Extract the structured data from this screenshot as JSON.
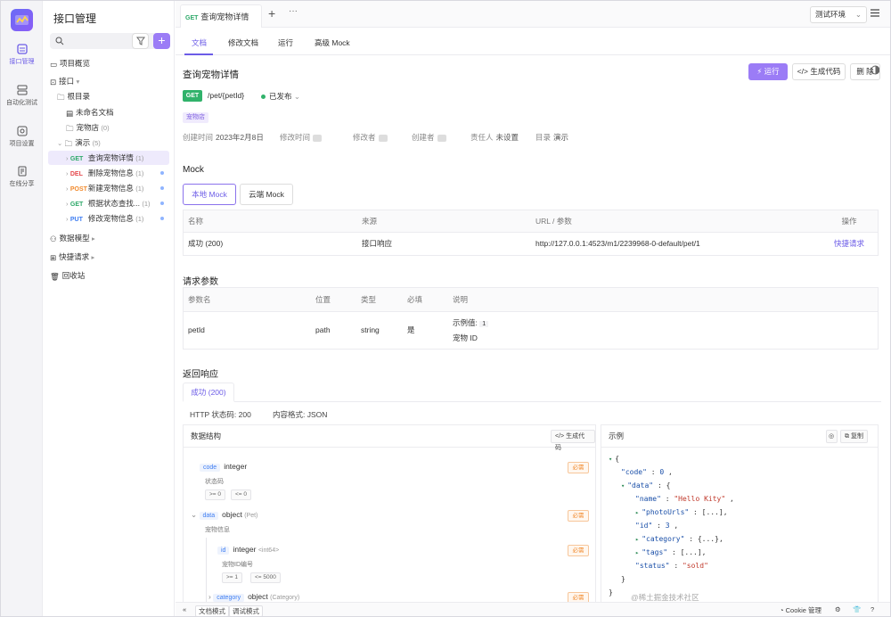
{
  "sidebar_rail": {
    "items": [
      {
        "label": "接口管理",
        "icon": "api-icon",
        "active": true
      },
      {
        "label": "自动化测试",
        "icon": "automation-icon",
        "active": false
      },
      {
        "label": "项目设置",
        "icon": "settings-icon",
        "active": false
      },
      {
        "label": "在线分享",
        "icon": "share-icon",
        "active": false
      }
    ]
  },
  "tree": {
    "title": "接口管理",
    "overview": "项目概览",
    "api_root": "接口",
    "root_dir": "根目录",
    "unnamed_doc": "未命名文档",
    "pet_store": "宠物店",
    "pet_store_count": "(0)",
    "demo": "演示",
    "demo_count": "(5)",
    "endpoints": [
      {
        "method": "GET",
        "name": "查询宠物详情",
        "count": "(1)"
      },
      {
        "method": "DEL",
        "name": "删除宠物信息",
        "count": "(1)"
      },
      {
        "method": "POST",
        "name": "新建宠物信息",
        "count": "(1)"
      },
      {
        "method": "GET",
        "name": "根据状态查找...",
        "count": "(1)"
      },
      {
        "method": "PUT",
        "name": "修改宠物信息",
        "count": "(1)"
      }
    ],
    "data_models": "数据模型",
    "quick_request": "快捷请求",
    "recycle_bin": "回收站"
  },
  "tabbar": {
    "tab_method": "GET",
    "tab_label": "查询宠物详情",
    "env": "测试环境"
  },
  "subtabs": [
    "文档",
    "修改文档",
    "运行",
    "高级 Mock"
  ],
  "api": {
    "title": "查询宠物详情",
    "run": "运行",
    "gen_code": "生成代码",
    "delete": "删 除",
    "method": "GET",
    "path": "/pet/{petId}",
    "status": "已发布",
    "tag": "宠物店",
    "created_label": "创建时间",
    "created_value": "2023年2月8日",
    "modified_label": "修改时间",
    "modifier_label": "修改者",
    "creator_label": "创建者",
    "owner_label": "责任人",
    "owner_value": "未设置",
    "dir_label": "目录",
    "dir_value": "演示"
  },
  "mock": {
    "heading": "Mock",
    "tabs": [
      "本地 Mock",
      "云端 Mock"
    ],
    "headers": [
      "名称",
      "来源",
      "URL / 参数",
      "操作"
    ],
    "rows": [
      {
        "name": "成功 (200)",
        "source": "接口响应",
        "url": "http://127.0.0.1:4523/m1/2239968-0-default/pet/1",
        "action": "快捷请求"
      }
    ]
  },
  "params": {
    "heading": "请求参数",
    "headers": [
      "参数名",
      "位置",
      "类型",
      "必填",
      "说明"
    ],
    "rows": [
      {
        "name": "petId",
        "in": "path",
        "type": "string",
        "required": "是",
        "example_label": "示例值:",
        "example": "1",
        "desc": "宠物 ID"
      }
    ]
  },
  "response": {
    "heading": "返回响应",
    "tab": "成功 (200)",
    "http_status": "HTTP 状态码: 200",
    "content_type": "内容格式: JSON",
    "schema_title": "数据结构",
    "schema_gen": "生成代码",
    "example_title": "示例",
    "copy": "复制",
    "fields": [
      {
        "name": "code",
        "type": "integer",
        "sub": "",
        "desc": "状态码",
        "required": "必需",
        "chips": [
          ">= 0",
          "<= 0"
        ]
      },
      {
        "name": "data",
        "type": "object",
        "sub": "(Pet)",
        "desc": "宠物信息",
        "required": "必需",
        "chips": []
      },
      {
        "name": "id",
        "type": "integer",
        "sub": "<int64>",
        "desc": "宠物ID编号",
        "required": "必需",
        "chips": [
          ">= 1",
          "<= 5000"
        ]
      },
      {
        "name": "category",
        "type": "object",
        "sub": "(Category)",
        "desc": "",
        "required": "必需",
        "chips": []
      }
    ],
    "json_lines": [
      {
        "t": "{"
      },
      {
        "k": "\"code\"",
        "v": "0"
      },
      {
        "k": "\"data\"",
        "v": "{"
      },
      {
        "k": "\"name\"",
        "s": "\"Hello Kity\""
      },
      {
        "k": "\"photoUrls\"",
        "v": "[...]"
      },
      {
        "k": "\"id\"",
        "v": "3"
      },
      {
        "k": "\"category\"",
        "v": "{...}"
      },
      {
        "k": "\"tags\"",
        "v": "[...]"
      },
      {
        "k": "\"status\"",
        "s": "\"sold\""
      },
      {
        "t": "}"
      },
      {
        "t": "}"
      }
    ]
  },
  "footer": {
    "doc_mode": "文档模式",
    "debug_mode": "调试模式",
    "cookie": "Cookie 管理",
    "watermark": "@稀土掘金技术社区"
  }
}
